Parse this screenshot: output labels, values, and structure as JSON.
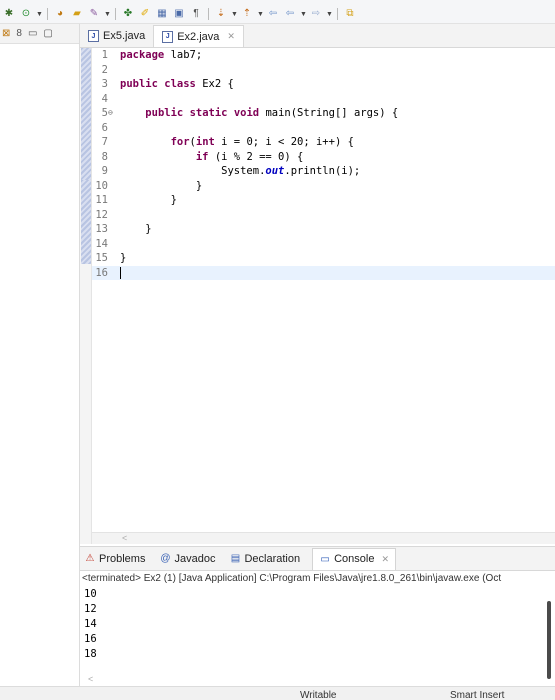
{
  "toolbar": {
    "icons": [
      "debug-icon",
      "run-icon",
      "new-java-project-icon",
      "open-folder-icon",
      "wrench-icon",
      "pin-icon",
      "highlight-icon",
      "show-whitespace-icon",
      "pilcrow-icon",
      "next-annotation-icon",
      "prev-annotation-icon",
      "back-icon",
      "forward-icon",
      "new-window-icon"
    ]
  },
  "left_panel": {
    "icons": [
      "package-explorer-icon",
      "link-icon",
      "minimize-icon",
      "maximize-icon"
    ]
  },
  "editor": {
    "tabs": [
      {
        "label": "Ex5.java",
        "active": false
      },
      {
        "label": "Ex2.java",
        "active": true,
        "close": "✕"
      }
    ],
    "lines": [
      {
        "n": "1",
        "fold": "",
        "html": "<span class=\"kw\">package</span> lab7;"
      },
      {
        "n": "2",
        "fold": "",
        "html": ""
      },
      {
        "n": "3",
        "fold": "",
        "html": "<span class=\"kw\">public</span> <span class=\"kw\">class</span> Ex2 {"
      },
      {
        "n": "4",
        "fold": "",
        "html": ""
      },
      {
        "n": "5",
        "fold": "⊖",
        "html": "    <span class=\"kw\">public</span> <span class=\"kw\">static</span> <span class=\"kw\">void</span> main(String[] args) {"
      },
      {
        "n": "6",
        "fold": "",
        "html": ""
      },
      {
        "n": "7",
        "fold": "",
        "html": "        <span class=\"kw\">for</span>(<span class=\"kw\">int</span> i = 0; i &lt; 20; i++) {"
      },
      {
        "n": "8",
        "fold": "",
        "html": "            <span class=\"kw\">if</span> (i % 2 == 0) {"
      },
      {
        "n": "9",
        "fold": "",
        "html": "                System.<span class=\"fld\">out</span>.println(i);"
      },
      {
        "n": "10",
        "fold": "",
        "html": "            }"
      },
      {
        "n": "11",
        "fold": "",
        "html": "        }"
      },
      {
        "n": "12",
        "fold": "",
        "html": ""
      },
      {
        "n": "13",
        "fold": "",
        "html": "    }"
      },
      {
        "n": "14",
        "fold": "",
        "html": ""
      },
      {
        "n": "15",
        "fold": "",
        "html": "}"
      },
      {
        "n": "16",
        "fold": "",
        "html": "",
        "current": true
      }
    ],
    "hscroll_glyph": "<"
  },
  "console": {
    "tabs": [
      {
        "label": "Problems",
        "icon": "problems-icon",
        "glyph": "⚠"
      },
      {
        "label": "Javadoc",
        "icon": "javadoc-icon",
        "glyph": "@"
      },
      {
        "label": "Declaration",
        "icon": "declaration-icon",
        "glyph": "▤"
      },
      {
        "label": "Console",
        "icon": "console-icon",
        "glyph": "▭",
        "close": "✕"
      }
    ],
    "terminated": "<terminated> Ex2 (1) [Java Application] C:\\Program Files\\Java\\jre1.8.0_261\\bin\\javaw.exe  (Oct",
    "output": [
      "10",
      "12",
      "14",
      "16",
      "18"
    ],
    "hscroll_glyph": "<"
  },
  "status": {
    "writable": "Writable",
    "insert_mode": "Smart Insert"
  }
}
